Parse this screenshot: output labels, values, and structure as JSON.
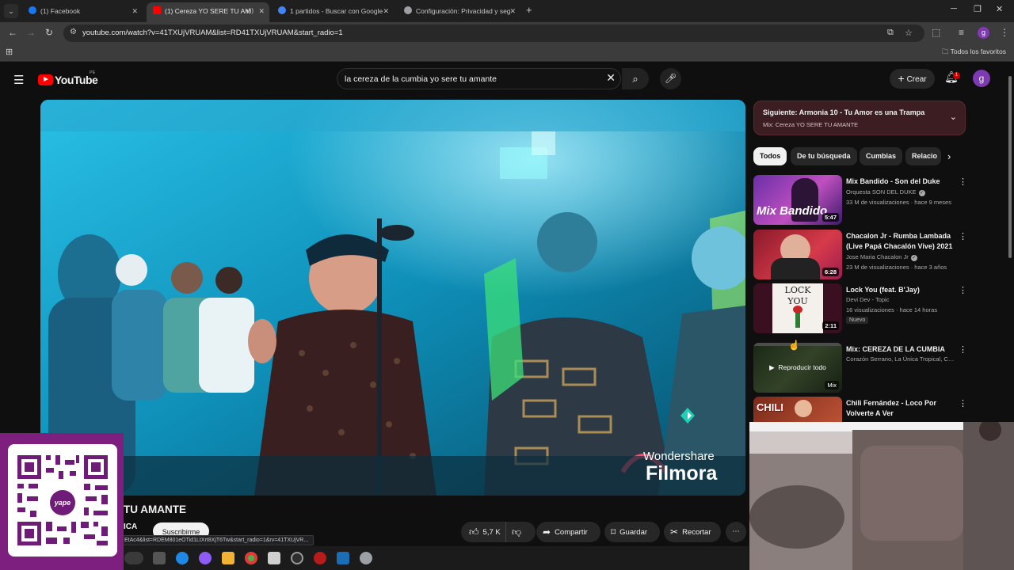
{
  "browser": {
    "tabs": [
      {
        "title": "(1) Facebook",
        "active": false,
        "color": "#1877f2"
      },
      {
        "title": "(1) Cereza YO SERE TU AM",
        "active": true,
        "color": "#ff0000"
      },
      {
        "title": "1 partidos - Buscar con Google",
        "active": false,
        "color": "#4285f4"
      },
      {
        "title": "Configuración: Privacidad y seg",
        "active": false,
        "color": "#9aa0a6"
      }
    ],
    "url": "youtube.com/watch?v=41TXUjVRUAM&list=RD41TXUjVRUAM&start_radio=1",
    "bookmarks_label": "Todos los favoritos",
    "profile_initial": "g"
  },
  "youtube": {
    "logo_text": "YouTube",
    "country_code": "PE",
    "search_query": "la cereza de la cumbia yo sere tu amante",
    "create_label": "Crear",
    "notification_count": "1",
    "avatar_initial": "g"
  },
  "video": {
    "title_fragment": "TU AMANTE",
    "channel_fragment": "ICA",
    "subscribe_label": "Suscribirme",
    "watermark_line1": "Wondershare",
    "watermark_line2": "Filmora",
    "status_url": "EtAc4&list=RDEM801eOTid1LtXrt8XjT6Tw&start_radio=1&rv=41TXUjVR...",
    "likes": "5,7 K",
    "share_label": "Compartir",
    "save_label": "Guardar",
    "clip_label": "Recortar"
  },
  "up_next": {
    "title": "Siguiente: Armonia 10 - Tu Amor es una Trampa",
    "subtitle": "Mix: Cereza YO SERE TU AMANTE"
  },
  "chips": [
    "Todos",
    "De tu búsqueda",
    "Cumbias",
    "Relacio"
  ],
  "recommendations": [
    {
      "title": "Mix Bandido - Son del Duke",
      "channel": "Orquesta SON DEL DUKE",
      "verified": true,
      "meta": "33 M de visualizaciones · hace 9 meses",
      "duration": "5:47",
      "thumb_text": "Mix Bandido"
    },
    {
      "title": "Chacalon Jr - Rumba Lambada (Live Papá Chacalón Vive) 2021",
      "channel": "Jose Maria Chacalon Jr",
      "verified": true,
      "meta": "23 M de visualizaciones · hace 3 años",
      "duration": "6:28",
      "thumb_text": ""
    },
    {
      "title": "Lock You (feat. B'Jay)",
      "channel": "Devi Dev - Topic",
      "verified": false,
      "meta": "16 visualizaciones · hace 14 horas",
      "badge": "Nuevo",
      "duration": "2:11",
      "thumb_text": "LOCK YOU"
    },
    {
      "title": "Mix: CEREZA DE LA CUMBIA",
      "channel": "Corazón Serrano, La Única Tropical, CER...",
      "verified": false,
      "meta": "",
      "duration": "Mix",
      "play_all": "Reproducir todo",
      "thumb_text": ""
    },
    {
      "title": "Chili Fernández - Loco Por Volverte A Ver",
      "channel": "",
      "verified": false,
      "meta": "",
      "duration": "",
      "thumb_text": "CHILI"
    }
  ],
  "qr_brand": "yape",
  "colors": {
    "accent_red": "#ff0000",
    "qr_panel": "#7d1f7e",
    "next_card": "#3b1d22"
  }
}
